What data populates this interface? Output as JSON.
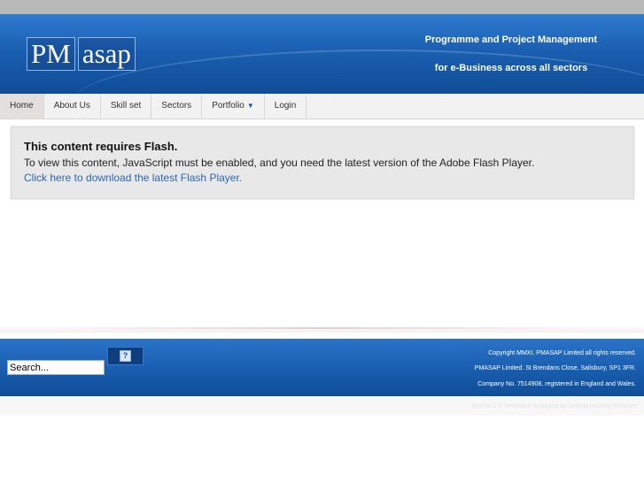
{
  "header": {
    "logo_part1": "PM",
    "logo_part2": "asap",
    "tagline_line1": "Programme and Project Management",
    "tagline_line2": "for e-Business across all sectors"
  },
  "nav": {
    "items": [
      {
        "label": "Home",
        "active": true
      },
      {
        "label": "About Us"
      },
      {
        "label": "Skill set"
      },
      {
        "label": "Sectors"
      },
      {
        "label": "Portfolio",
        "has_dropdown": true
      },
      {
        "label": "Login"
      }
    ],
    "dropdown_caret": "▼"
  },
  "flash": {
    "title": "This content requires Flash.",
    "description": "To view this content, JavaScript must be enabled, and you need the latest version of the Adobe Flash Player.",
    "link_text": "Click here to download the latest Flash Player."
  },
  "footer": {
    "search_placeholder": "Search...",
    "help_icon": "?",
    "copyright_line1": "Copyright MMXI. PMASAP Limited all rights reserved.",
    "copyright_line2": "PMASAP Limited. St Brendans Close, Salisbury, SP1 3FR.",
    "copyright_line3": "Company No. 7514908, registered in England and Wales.",
    "credit": "Joomla 1.6 Templates designed by Joomla Hosting Reviews"
  },
  "colors": {
    "header_blue": "#1a5fb1",
    "link_blue": "#2a67b7",
    "nav_bg": "#f2f2f2"
  }
}
